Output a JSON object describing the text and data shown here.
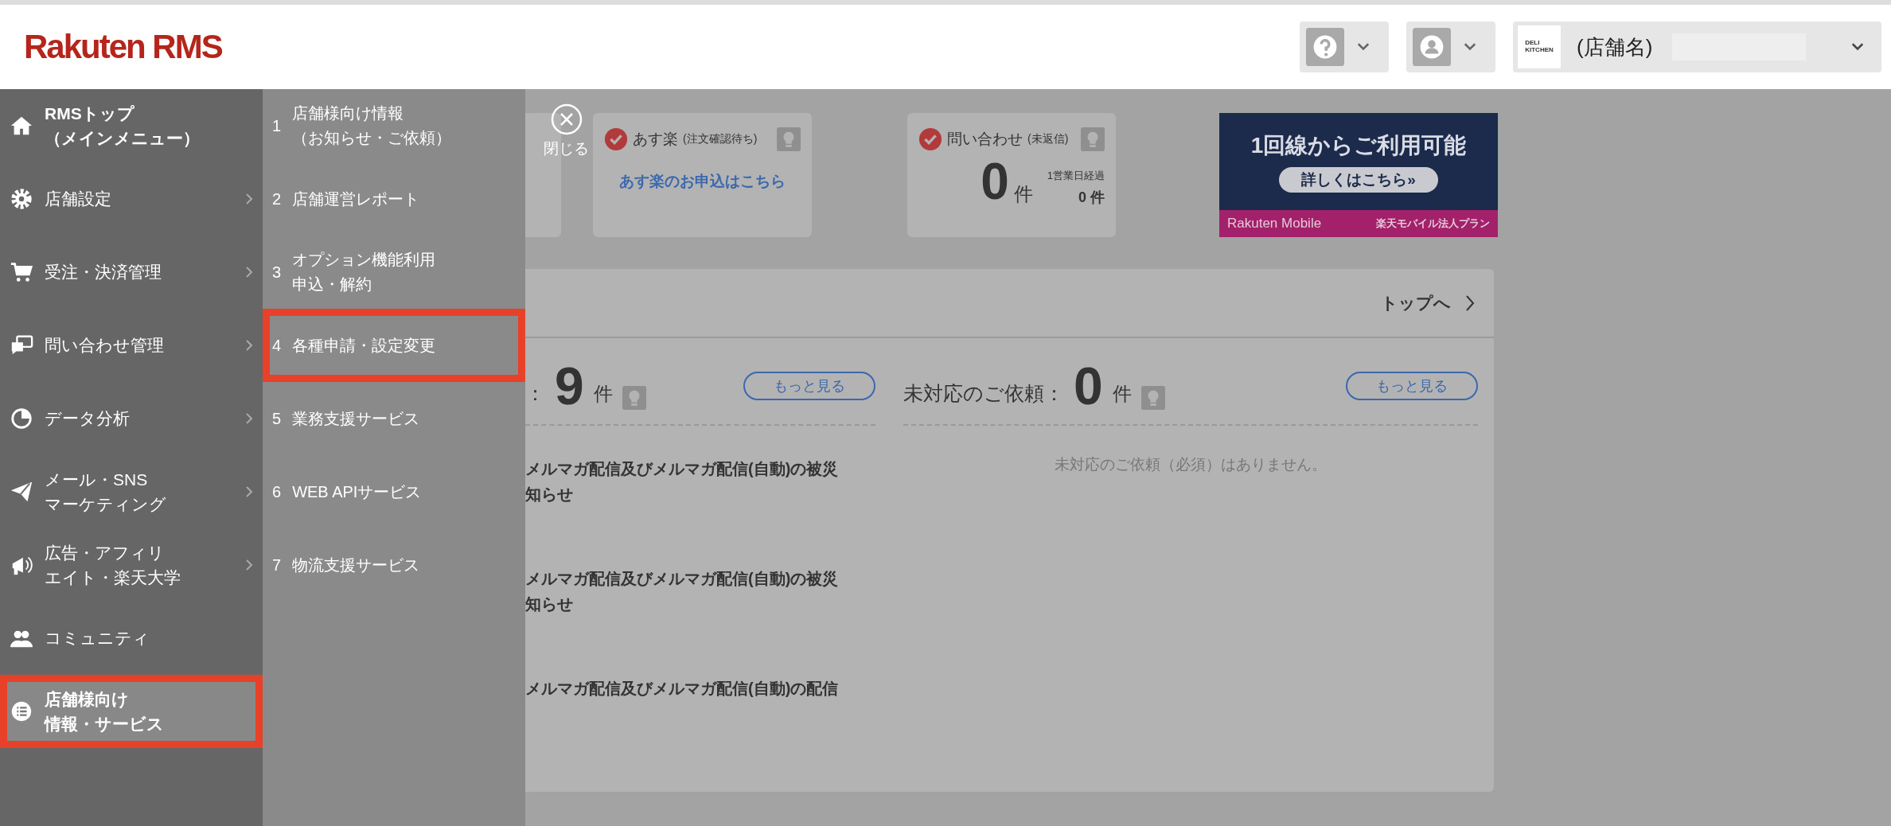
{
  "header": {
    "logo": "Rakuten RMS",
    "shop_selector": {
      "logo_text": "DELI\nKITCHEN",
      "name": "(店舗名)"
    }
  },
  "nav": [
    {
      "kind": "top",
      "lines": [
        "RMSトップ",
        "（メインメニュー）"
      ],
      "has_submenu": false,
      "selected": false,
      "highlighted": false
    },
    {
      "kind": "menu",
      "lines": [
        "店舗設定"
      ],
      "has_submenu": true,
      "selected": false,
      "highlighted": false
    },
    {
      "kind": "menu",
      "lines": [
        "受注・決済管理"
      ],
      "has_submenu": true,
      "selected": false,
      "highlighted": false
    },
    {
      "kind": "menu",
      "lines": [
        "問い合わせ管理"
      ],
      "has_submenu": true,
      "selected": false,
      "highlighted": false
    },
    {
      "kind": "menu",
      "lines": [
        "データ分析"
      ],
      "has_submenu": true,
      "selected": false,
      "highlighted": false
    },
    {
      "kind": "menu",
      "lines": [
        "メール・SNS",
        "マーケティング"
      ],
      "has_submenu": true,
      "selected": false,
      "highlighted": false
    },
    {
      "kind": "menu",
      "lines": [
        "広告・アフィリ",
        "エイト・楽天大学"
      ],
      "has_submenu": true,
      "selected": false,
      "highlighted": false
    },
    {
      "kind": "menu",
      "lines": [
        "コミュニティ"
      ],
      "has_submenu": false,
      "selected": false,
      "highlighted": false
    },
    {
      "kind": "menu",
      "lines": [
        "店舗様向け",
        "情報・サービス"
      ],
      "has_submenu": false,
      "selected": true,
      "highlighted": true
    }
  ],
  "submenu": [
    {
      "number": "1",
      "lines": [
        "店舗様向け情報",
        "（お知らせ・ご依頼）"
      ],
      "highlighted": false
    },
    {
      "number": "2",
      "lines": [
        "店舗運営レポート"
      ],
      "highlighted": false
    },
    {
      "number": "3",
      "lines": [
        "オプション機能利用",
        "申込・解約"
      ],
      "highlighted": false
    },
    {
      "number": "4",
      "lines": [
        "各種申請・設定変更"
      ],
      "highlighted": true
    },
    {
      "number": "5",
      "lines": [
        "業務支援サービス"
      ],
      "highlighted": false
    },
    {
      "number": "6",
      "lines": [
        "WEB APIサービス"
      ],
      "highlighted": false
    },
    {
      "number": "7",
      "lines": [
        "物流支援サービス"
      ],
      "highlighted": false
    }
  ],
  "close_button": {
    "label": "閉じる"
  },
  "status_cards": [
    {
      "kind": "link",
      "title": "あす楽",
      "note": "(注文確認待ち)",
      "checked": true,
      "link": "あす楽のお申込はこちら"
    },
    {
      "kind": "count",
      "title": "問い合わせ",
      "note": "(未返信)",
      "checked": true,
      "count": "0",
      "unit": "件",
      "sub_label": "1営業日経過",
      "sub_count": "0 件"
    }
  ],
  "banner": {
    "headline": "1回線からご利用可能",
    "button": "詳しくはこちら»",
    "brand": "Rakuten Mobile",
    "plan": "楽天モバイル法人プラン"
  },
  "panel": {
    "top_link": "トップへ",
    "columns": [
      {
        "label": "：",
        "count": "9",
        "unit": "件",
        "more": "もっと見る",
        "items": [
          [
            "メルマガ配信及びメルマガ配信(自動)の被災",
            "知らせ"
          ],
          [
            "メルマガ配信及びメルマガ配信(自動)の被災",
            "知らせ"
          ],
          [
            "メルマガ配信及びメルマガ配信(自動)の配信"
          ]
        ]
      },
      {
        "label": "未対応のご依頼：",
        "count": "0",
        "unit": "件",
        "more": "もっと見る",
        "empty": "未対応のご依頼（必須）はありません。"
      }
    ]
  }
}
